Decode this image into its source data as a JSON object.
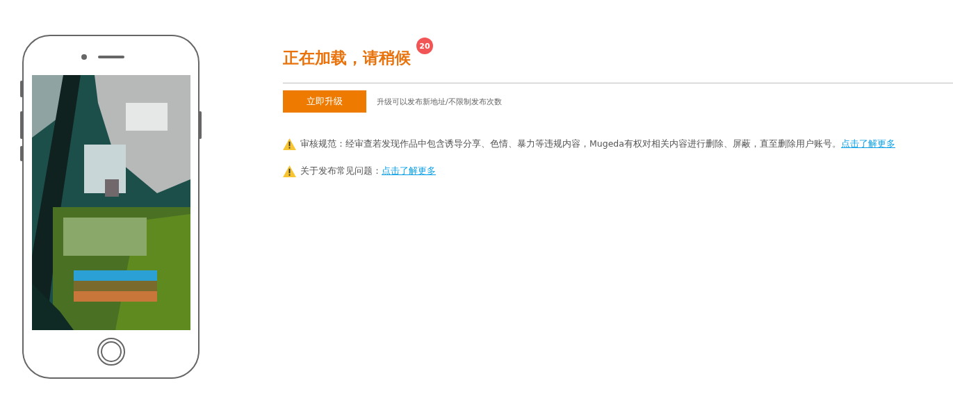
{
  "title": "正在加载，请稍候",
  "badge": "20",
  "upgrade_button": "立即升级",
  "upgrade_hint": "升级可以发布新地址/不限制发布次数",
  "notices": [
    {
      "text": "审核规范：经审查若发现作品中包含诱导分享、色情、暴力等违规内容，Mugeda有权对相关内容进行删除、屏蔽，直至删除用户账号。",
      "link": "点击了解更多"
    },
    {
      "text": "关于发布常见问题：",
      "link": "点击了解更多"
    }
  ]
}
